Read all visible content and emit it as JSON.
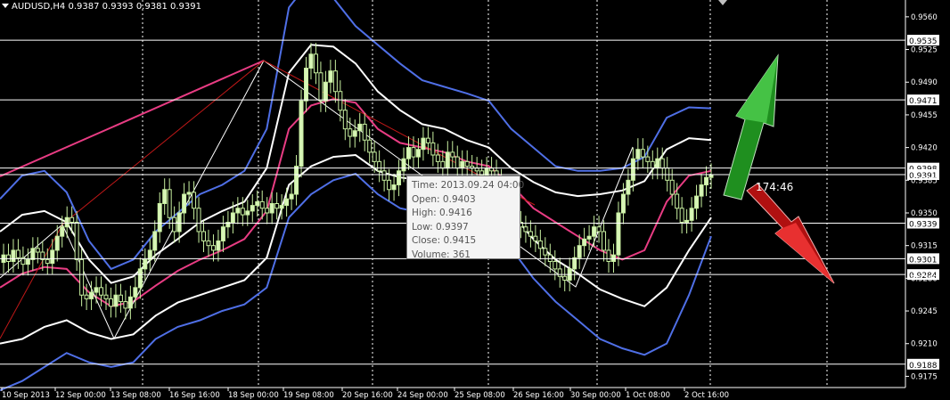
{
  "header": {
    "symbol_label": "AUDUSD,H4",
    "ohlc_text": "0.9387 0.9393 0.9381 0.9391"
  },
  "price_axis": {
    "ticks": [
      "0.9560",
      "0.9525",
      "0.9490",
      "0.9455",
      "0.9420",
      "0.9385",
      "0.9350",
      "0.9315",
      "0.9280",
      "0.9245",
      "0.9210",
      "0.9175"
    ],
    "tick_values": [
      0.956,
      0.9525,
      0.949,
      0.9455,
      0.942,
      0.9385,
      0.935,
      0.9315,
      0.928,
      0.9245,
      0.921,
      0.9175
    ],
    "level_values": [
      0.9535,
      0.9471,
      0.9398,
      0.9391,
      0.9339,
      0.9301,
      0.9284,
      0.9188
    ],
    "level_labels": [
      "0.9535",
      "0.9471",
      "0.9398",
      "0.9391",
      "0.9339",
      "0.9301",
      "0.9284",
      "0.9188"
    ],
    "range": [
      0.9163,
      0.9578
    ]
  },
  "time_axis": {
    "labels": [
      "10 Sep 2013",
      "12 Sep 00:00",
      "13 Sep 08:00",
      "16 Sep 16:00",
      "18 Sep 00:00",
      "19 Sep 08:00",
      "20 Sep 16:00",
      "24 Sep 00:00",
      "25 Sep 08:00",
      "26 Sep 16:00",
      "30 Sep 00:00",
      "1 Oct 08:00",
      "2 Oct 16:00"
    ]
  },
  "tooltip": {
    "time": "Time: 2013.09.24 04:00",
    "open": "Open: 0.9403",
    "high": "High: 0.9416",
    "low": "Low:  0.9397",
    "close": "Close: 0.9415",
    "volume": "Volume: 361"
  },
  "timer_text": "174:46",
  "colors": {
    "background": "#000000",
    "bull_candle": "#d8f5b8",
    "bear_candle": "#000000",
    "candle_outline": "#c8f0a0",
    "blue_band": "#4f6fe6",
    "white_band": "#ffffff",
    "pink_band": "#e83c83",
    "level_line": "#ffffff",
    "grid": "#ffffff",
    "up_arrow": "#2a9a2a",
    "down_arrow": "#cc1111"
  },
  "chart_data": {
    "type": "candlestick",
    "symbol": "AUDUSD",
    "timeframe": "H4",
    "ylim": [
      0.9163,
      0.9578
    ],
    "x_tick_labels": [
      "10 Sep 2013",
      "12 Sep 00:00",
      "13 Sep 08:00",
      "16 Sep 16:00",
      "18 Sep 00:00",
      "19 Sep 08:00",
      "20 Sep 16:00",
      "24 Sep 00:00",
      "25 Sep 08:00",
      "26 Sep 16:00",
      "30 Sep 00:00",
      "1 Oct 08:00",
      "2 Oct 16:00"
    ],
    "current_price": 0.9391,
    "candles_close": [
      0.9305,
      0.9298,
      0.931,
      0.9302,
      0.9295,
      0.93,
      0.9312,
      0.9308,
      0.93,
      0.9296,
      0.931,
      0.9325,
      0.9335,
      0.9345,
      0.934,
      0.93,
      0.9262,
      0.9258,
      0.9265,
      0.927,
      0.9262,
      0.9258,
      0.925,
      0.9262,
      0.9255,
      0.9248,
      0.926,
      0.927,
      0.929,
      0.93,
      0.931,
      0.933,
      0.936,
      0.9375,
      0.9345,
      0.933,
      0.935,
      0.937,
      0.9372,
      0.9355,
      0.933,
      0.932,
      0.9315,
      0.931,
      0.932,
      0.9335,
      0.934,
      0.935,
      0.9355,
      0.9348,
      0.9352,
      0.9358,
      0.9362,
      0.9355,
      0.935,
      0.936,
      0.9355,
      0.9358,
      0.9365,
      0.937,
      0.94,
      0.947,
      0.9505,
      0.952,
      0.95,
      0.947,
      0.949,
      0.9502,
      0.948,
      0.946,
      0.944,
      0.9432,
      0.9438,
      0.9445,
      0.9428,
      0.9415,
      0.9405,
      0.9395,
      0.9385,
      0.9375,
      0.938,
      0.9395,
      0.9408,
      0.942,
      0.941,
      0.9418,
      0.943,
      0.9425,
      0.9412,
      0.9405,
      0.9398,
      0.9415,
      0.941,
      0.9398,
      0.9405,
      0.94,
      0.9398,
      0.9395,
      0.939,
      0.9398,
      0.9395,
      0.9385,
      0.9372,
      0.936,
      0.9352,
      0.934,
      0.9335,
      0.933,
      0.9325,
      0.932,
      0.9312,
      0.9305,
      0.9298,
      0.929,
      0.9282,
      0.9278,
      0.929,
      0.9302,
      0.9315,
      0.9322,
      0.9325,
      0.9335,
      0.933,
      0.931,
      0.9298,
      0.9305,
      0.935,
      0.937,
      0.9385,
      0.9408,
      0.9418,
      0.941,
      0.9405,
      0.9398,
      0.9408,
      0.9398,
      0.9385,
      0.937,
      0.9355,
      0.934,
      0.9342,
      0.9355,
      0.9368,
      0.938,
      0.9388,
      0.9391
    ],
    "bands": [
      {
        "color": "blue",
        "values": [
          0.9365,
          0.939,
          0.9395,
          0.9372,
          0.932,
          0.929,
          0.93,
          0.933,
          0.935,
          0.937,
          0.938,
          0.9395,
          0.944,
          0.957,
          0.96,
          0.958,
          0.955,
          0.953,
          0.951,
          0.9492,
          0.9485,
          0.9478,
          0.947,
          0.944,
          0.942,
          0.94,
          0.9395,
          0.9395,
          0.9398,
          0.941,
          0.9452,
          0.9463,
          0.9462
        ]
      },
      {
        "color": "white",
        "values": [
          0.933,
          0.9348,
          0.9352,
          0.934,
          0.93,
          0.9275,
          0.9282,
          0.9305,
          0.9322,
          0.934,
          0.9352,
          0.9362,
          0.9398,
          0.95,
          0.953,
          0.9528,
          0.951,
          0.948,
          0.946,
          0.9445,
          0.944,
          0.9428,
          0.942,
          0.9398,
          0.9383,
          0.9372,
          0.9368,
          0.937,
          0.9374,
          0.9384,
          0.9418,
          0.943,
          0.9428
        ]
      },
      {
        "color": "pink",
        "values": [
          0.927,
          0.9285,
          0.9292,
          0.929,
          0.9265,
          0.925,
          0.9255,
          0.9272,
          0.9288,
          0.93,
          0.931,
          0.9322,
          0.9352,
          0.944,
          0.9465,
          0.9472,
          0.9468,
          0.944,
          0.9425,
          0.942,
          0.9415,
          0.9405,
          0.94,
          0.938,
          0.9355,
          0.934,
          0.9325,
          0.931,
          0.93,
          0.931,
          0.9362,
          0.939,
          0.9395
        ]
      },
      {
        "color": "white",
        "values": [
          0.921,
          0.9215,
          0.9228,
          0.9235,
          0.9222,
          0.9215,
          0.922,
          0.924,
          0.9254,
          0.9262,
          0.927,
          0.9278,
          0.9302,
          0.938,
          0.94,
          0.941,
          0.9412,
          0.9395,
          0.9388,
          0.9385,
          0.938,
          0.9375,
          0.9368,
          0.935,
          0.9322,
          0.93,
          0.9285,
          0.9268,
          0.9258,
          0.925,
          0.927,
          0.931,
          0.9345
        ]
      },
      {
        "color": "blue",
        "values": [
          0.916,
          0.917,
          0.9185,
          0.92,
          0.919,
          0.9185,
          0.919,
          0.9215,
          0.9228,
          0.9235,
          0.9245,
          0.9252,
          0.927,
          0.9345,
          0.937,
          0.9385,
          0.9392,
          0.937,
          0.9355,
          0.935,
          0.9342,
          0.934,
          0.9335,
          0.9312,
          0.928,
          0.9255,
          0.9235,
          0.9215,
          0.9205,
          0.9198,
          0.921,
          0.9262,
          0.9325
        ]
      }
    ]
  }
}
